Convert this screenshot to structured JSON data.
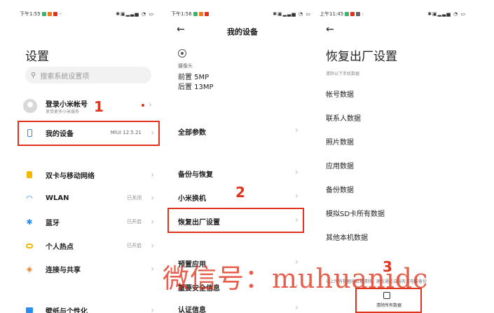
{
  "panel1": {
    "status_time": "下午1:55",
    "title": "设置",
    "search_placeholder": "搜索系统设置项",
    "account": {
      "name": "登录小米帐号",
      "sub": "享受更多小米服务"
    },
    "my_device": {
      "label": "我的设备",
      "value": "MIUI 12.5.21"
    },
    "items": [
      {
        "label": "双卡与移动网络",
        "value": "",
        "icon": "sim-icon"
      },
      {
        "label": "WLAN",
        "value": "已关闭",
        "icon": "wifi-icon"
      },
      {
        "label": "蓝牙",
        "value": "已开启",
        "icon": "bluetooth-icon"
      },
      {
        "label": "个人热点",
        "value": "已开启",
        "icon": "hotspot-icon"
      },
      {
        "label": "连接与共享",
        "value": "",
        "icon": "share-icon"
      },
      {
        "label": "壁纸与个性化",
        "value": "",
        "icon": "wallpaper-icon"
      }
    ],
    "annotation": "1"
  },
  "panel2": {
    "status_time": "下午1:56",
    "title": "我的设备",
    "camera_label": "摄像头",
    "front": "前置 5MP",
    "rear": "后置 13MP",
    "items": [
      "全部参数",
      "备份与恢复",
      "小米换机",
      "恢复出厂设置",
      "预置应用",
      "重要安全信息",
      "认证信息"
    ],
    "annotation": "2"
  },
  "panel3": {
    "status_time": "上午11:45",
    "title": "恢复出厂设置",
    "subtitle": "清除以下手机数据",
    "items": [
      "帐号数据",
      "联系人数据",
      "照片数据",
      "应用数据",
      "备份数据",
      "模拟SD卡所有数据",
      "其他本机数据"
    ],
    "warning": "以上所有数据将会被清除，建议通过云服务或电脑备份",
    "erase_button": "清除所有数据",
    "annotation": "3"
  },
  "watermark": "微信号：muhuanidc",
  "colors": {
    "annotation": "#e0331c",
    "wlan": "#2a8df0",
    "bluetooth": "#2a8df0",
    "sim": "#f5b800",
    "hotspot": "#f5b800",
    "share": "#f07a1e",
    "wallpaper": "#2a8df0"
  }
}
